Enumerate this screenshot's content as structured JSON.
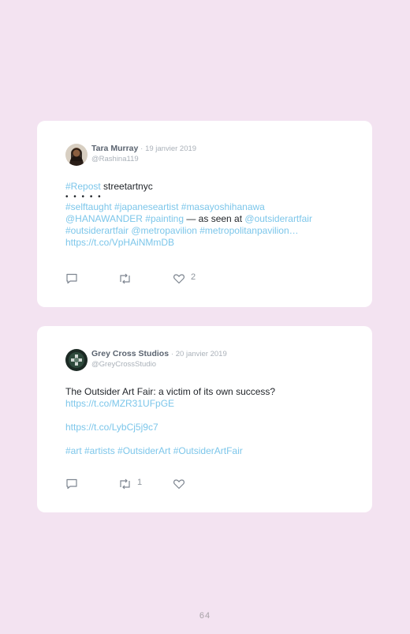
{
  "tweets": [
    {
      "author": "Tara Murray",
      "separator": "·",
      "date": "19 janvier 2019",
      "handle": "@Rashina119",
      "body": {
        "l1_link": "#Repost",
        "l1_text": " streetartnyc",
        "l2": "• • • • •",
        "l3": "#selftaught #japaneseartist #masayoshihanawa",
        "l4a": "@HANAWANDER #painting",
        "l4b": " — as seen at ",
        "l4c": "@outsiderartfair",
        "l5": "#outsiderartfair @metropavilion #metropolitanpavilion…",
        "l6": "https://t.co/VpHAiNMmDB"
      },
      "actions": {
        "reply_icon": "reply-icon",
        "retweet_icon": "retweet-icon",
        "like_icon": "heart-icon",
        "like_count": "2",
        "retweet_count": ""
      }
    },
    {
      "author": "Grey Cross Studios",
      "separator": "·",
      "date": "20 janvier 2019",
      "handle": "@GreyCrossStudio",
      "body": {
        "l1": "The Outsider Art Fair: a victim of its own success?",
        "l2": "https://t.co/MZR31UFpGE",
        "l3": "https://t.co/LybCj5j9c7",
        "l4": "#art #artists #OutsiderArt #OutsiderArtFair"
      },
      "actions": {
        "reply_icon": "reply-icon",
        "retweet_icon": "retweet-icon",
        "like_icon": "heart-icon",
        "retweet_count": "1",
        "like_count": ""
      }
    }
  ],
  "page_number": "64",
  "colors": {
    "background": "#f3e3f1",
    "link": "#7cc6ea",
    "meta": "#aab1b9",
    "name": "#5b6470"
  }
}
